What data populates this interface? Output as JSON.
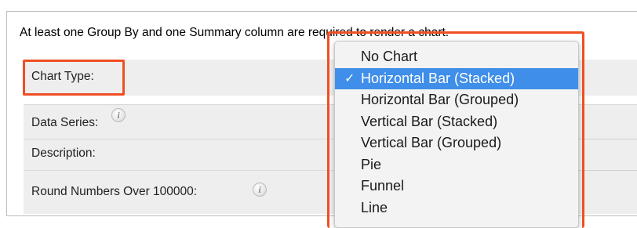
{
  "notice_text": "At least one Group By and one Summary column are required to render a chart.",
  "fields": {
    "chart_type_label": "Chart Type:",
    "data_series_label": "Data Series:",
    "description_label": "Description:",
    "round_numbers_label": "Round Numbers Over 100000:",
    "info_icon_glyph": "i"
  },
  "chart_type_dropdown": {
    "selected_index": 1,
    "checkmark": "✓",
    "options": [
      "No Chart",
      "Horizontal Bar (Stacked)",
      "Horizontal Bar (Grouped)",
      "Vertical Bar (Stacked)",
      "Vertical Bar (Grouped)",
      "Pie",
      "Funnel",
      "Line"
    ]
  },
  "colors": {
    "highlight_frame": "#f04e23",
    "selected_option_bg": "#3f8ee9",
    "row_bg": "#eeeeee"
  }
}
